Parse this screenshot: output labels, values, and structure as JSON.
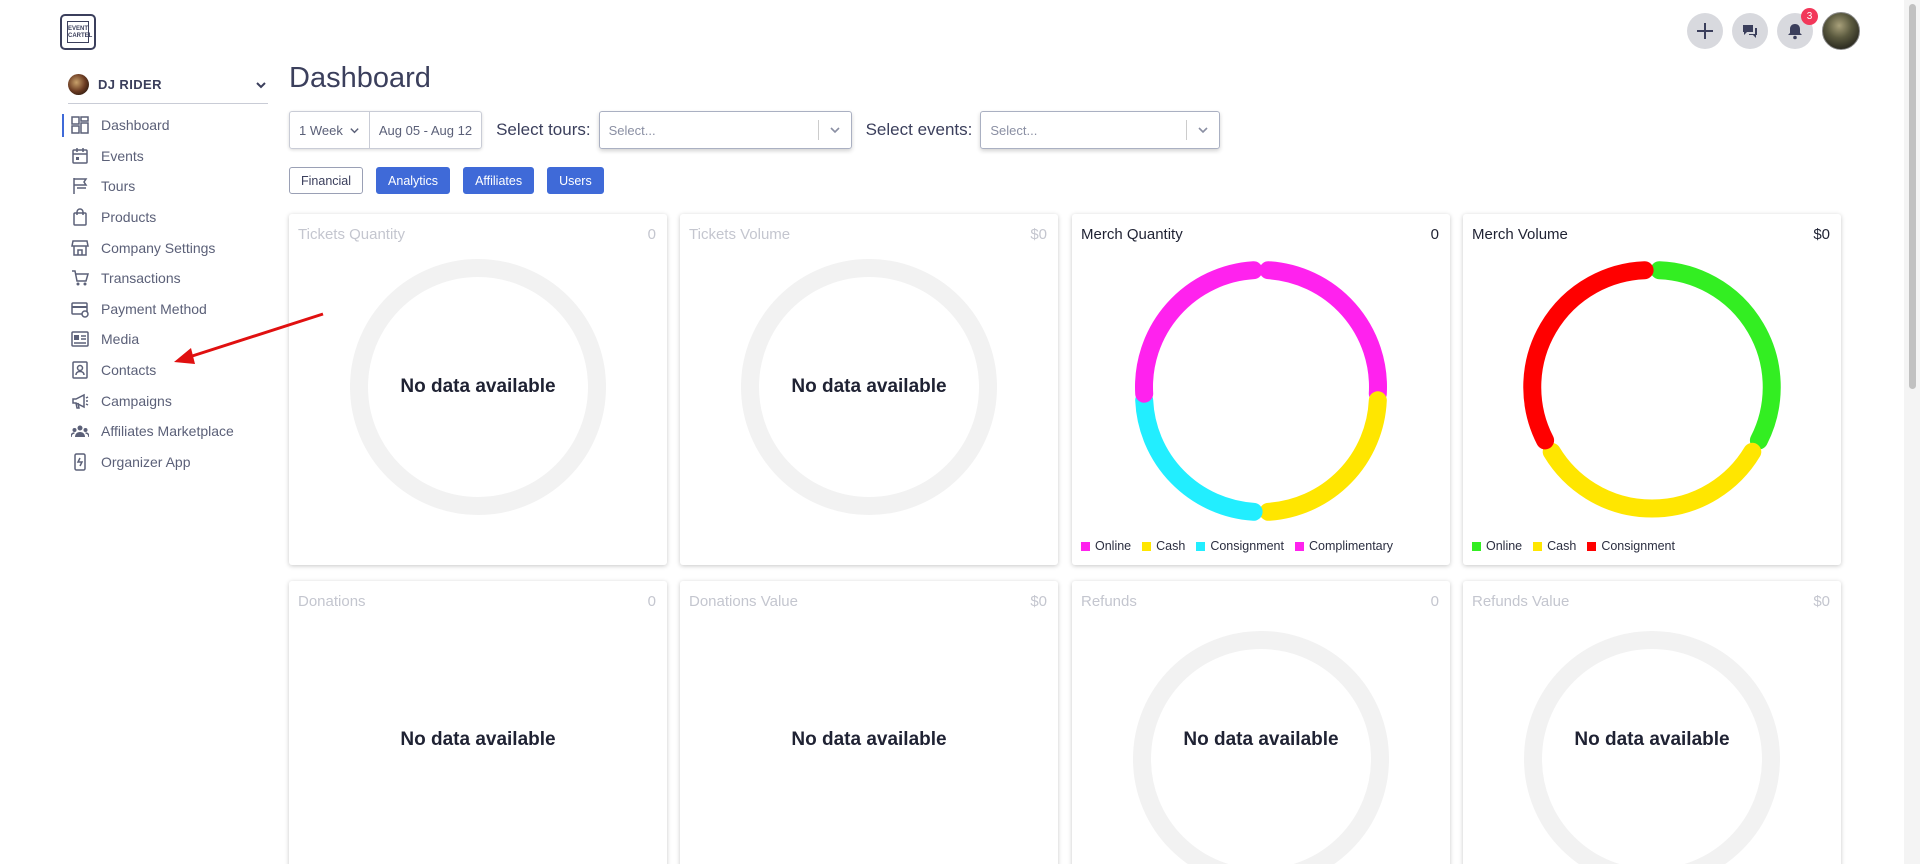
{
  "brand": {
    "logo_text": "EVENT CARTEL"
  },
  "header": {
    "notification_count": "3"
  },
  "org": {
    "name": "DJ RIDER"
  },
  "sidebar": {
    "items": [
      {
        "label": "Dashboard",
        "icon": "dashboard-icon",
        "active": true
      },
      {
        "label": "Events",
        "icon": "calendar-icon"
      },
      {
        "label": "Tours",
        "icon": "flag-icon"
      },
      {
        "label": "Products",
        "icon": "bag-icon"
      },
      {
        "label": "Company Settings",
        "icon": "store-icon"
      },
      {
        "label": "Transactions",
        "icon": "cart-icon"
      },
      {
        "label": "Payment Method",
        "icon": "card-settings-icon"
      },
      {
        "label": "Media",
        "icon": "media-icon"
      },
      {
        "label": "Contacts",
        "icon": "contact-icon"
      },
      {
        "label": "Campaigns",
        "icon": "megaphone-icon"
      },
      {
        "label": "Affiliates Marketplace",
        "icon": "group-icon"
      },
      {
        "label": "Organizer App",
        "icon": "phone-app-icon"
      }
    ]
  },
  "main": {
    "title": "Dashboard",
    "range": {
      "value": "1 Week",
      "dates": "Aug 05 - Aug 12"
    },
    "tours_filter": {
      "label": "Select tours:",
      "placeholder": "Select..."
    },
    "events_filter": {
      "label": "Select events:",
      "placeholder": "Select..."
    },
    "tabs": [
      {
        "label": "Financial",
        "style": "outline"
      },
      {
        "label": "Analytics",
        "style": "filled"
      },
      {
        "label": "Affiliates",
        "style": "filled"
      },
      {
        "label": "Users",
        "style": "filled"
      }
    ]
  },
  "colors": {
    "accent": "#3f6ad8",
    "magenta": "#ff22ee",
    "yellow": "#ffe600",
    "cyan": "#22eeff",
    "green": "#33ee22",
    "red": "#ff0000",
    "empty_ring": "#f2f2f2"
  },
  "chart_data": [
    {
      "type": "pie",
      "title": "Tickets Quantity",
      "total": "0",
      "message": "No data available",
      "labels": [],
      "values": []
    },
    {
      "type": "pie",
      "title": "Tickets Volume",
      "total": "$0",
      "message": "No data available",
      "labels": [],
      "values": []
    },
    {
      "type": "pie",
      "title": "Merch Quantity",
      "total": "0",
      "labels": [
        "Online",
        "Cash",
        "Consignment",
        "Complimentary"
      ],
      "values": [
        0,
        0,
        0,
        0
      ],
      "legend_colors": [
        "#ff22ee",
        "#ffe600",
        "#22eeff",
        "#ff22ee"
      ]
    },
    {
      "type": "pie",
      "title": "Merch Volume",
      "total": "$0",
      "labels": [
        "Online",
        "Cash",
        "Consignment"
      ],
      "values": [
        0,
        0,
        0
      ],
      "legend_colors": [
        "#33ee22",
        "#ffe600",
        "#ff0000"
      ]
    },
    {
      "type": "pie",
      "title": "Donations",
      "total": "0",
      "message": "No data available",
      "labels": [],
      "values": []
    },
    {
      "type": "pie",
      "title": "Donations Value",
      "total": "$0",
      "message": "No data available",
      "labels": [],
      "values": []
    },
    {
      "type": "pie",
      "title": "Refunds",
      "total": "0",
      "message": "No data available",
      "labels": [],
      "values": []
    },
    {
      "type": "pie",
      "title": "Refunds Value",
      "total": "$0",
      "message": "No data available",
      "labels": [],
      "values": []
    }
  ]
}
